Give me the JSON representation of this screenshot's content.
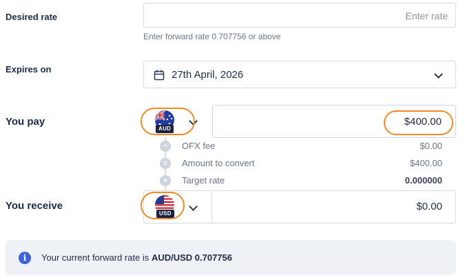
{
  "desired_rate": {
    "label": "Desired rate",
    "placeholder": "Enter rate",
    "hint": "Enter forward rate 0.707756 or above"
  },
  "expires": {
    "label": "Expires on",
    "date": "27th April, 2026"
  },
  "you_pay": {
    "label": "You pay",
    "currency": "AUD",
    "amount": "$400.00"
  },
  "fees": [
    {
      "icon": "minus-icon",
      "symbol": "−",
      "label": "OFX fee",
      "value": "$0.00",
      "bold": false
    },
    {
      "icon": "equals-icon",
      "symbol": "=",
      "label": "Amount to convert",
      "value": "$400.00",
      "bold": false
    },
    {
      "icon": "times-icon",
      "symbol": "×",
      "label": "Target rate",
      "value": "0.000000",
      "bold": true
    }
  ],
  "you_receive": {
    "label": "You receive",
    "currency": "USD",
    "amount": "$0.00"
  },
  "info": {
    "prefix": "Your current forward rate is ",
    "rate": "AUD/USD 0.707756"
  },
  "colors": {
    "highlight_ring": "#f08a24",
    "info_icon": "#3d63d6",
    "info_background": "#eef2f7"
  }
}
